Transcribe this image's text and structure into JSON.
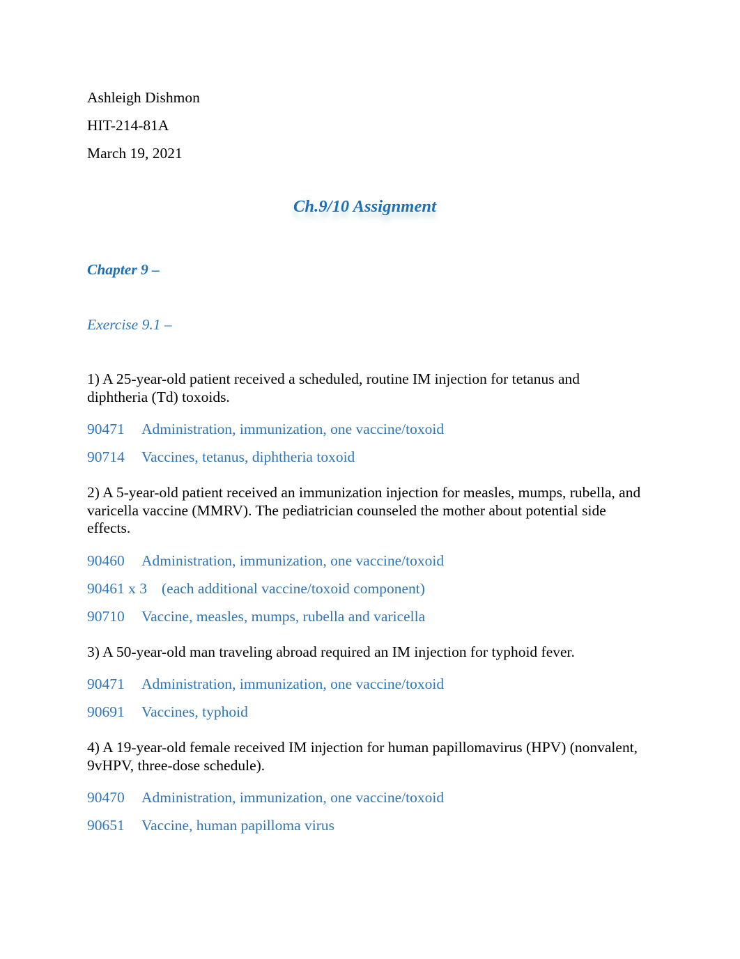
{
  "document": {
    "author": "Ashleigh Dishmon",
    "course": "HIT-214-81A",
    "date": "March 19, 2021",
    "title": "Ch.9/10 Assignment",
    "chapter_heading": "Chapter 9 –",
    "exercise_heading": "Exercise 9.1 –"
  },
  "colors": {
    "title_blue": "#1F6FB5",
    "code_blue": "#2E75B6",
    "body_black": "#000000",
    "page_background": "#FFFFFF"
  },
  "items": [
    {
      "question": "1) A 25-year-old patient received a scheduled, routine IM injection for tetanus and diphtheria (Td) toxoids.",
      "codes": [
        {
          "code": "90471",
          "description": "Administration, immunization, one vaccine/toxoid"
        },
        {
          "code": "90714",
          "description": "Vaccines, tetanus, diphtheria toxoid"
        }
      ]
    },
    {
      "question": "2) A 5-year-old patient received an immunization injection for measles, mumps, rubella, and varicella vaccine (MMRV). The pediatrician counseled the mother about potential side effects.",
      "codes": [
        {
          "code": "90460",
          "description": "Administration, immunization, one vaccine/toxoid"
        },
        {
          "code": "90461 x 3",
          "description": "(each additional vaccine/toxoid component)"
        },
        {
          "code": "90710",
          "description": "Vaccine, measles, mumps, rubella and varicella"
        }
      ]
    },
    {
      "question": "3) A 50-year-old man traveling abroad required an IM injection for typhoid fever.",
      "codes": [
        {
          "code": "90471",
          "description": "Administration, immunization, one vaccine/toxoid"
        },
        {
          "code": "90691",
          "description": "Vaccines, typhoid"
        }
      ]
    },
    {
      "question": "4) A 19-year-old female received IM injection for human papillomavirus (HPV) (nonvalent, 9vHPV, three-dose schedule).",
      "codes": [
        {
          "code": "90470",
          "description": "Administration, immunization, one vaccine/toxoid"
        },
        {
          "code": "90651",
          "description": "Vaccine, human papilloma virus"
        }
      ]
    }
  ]
}
